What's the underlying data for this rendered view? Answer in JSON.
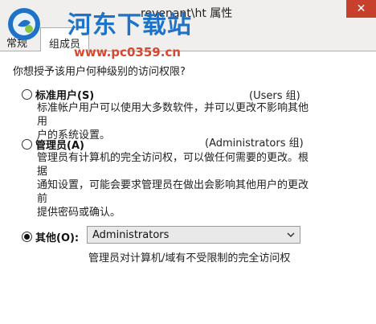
{
  "window": {
    "title": "revenant\\ht 属性",
    "close_glyph": "✕"
  },
  "watermark": {
    "main_text": "河东下载站",
    "url_text": "www.pc0359.cn"
  },
  "tabs": [
    {
      "label": "常规",
      "active": false
    },
    {
      "label": "组成员",
      "active": true
    }
  ],
  "question": "你想授予该用户何种级别的访问权限?",
  "options": [
    {
      "label": "标准用户(S)",
      "group": "(Users 组)",
      "description": [
        "标准帐户用户可以使用大多数软件，并可以更改不影响其他用",
        "户的系统设置。"
      ],
      "checked": false
    },
    {
      "label": "管理员(A)",
      "group": "(Administrators 组)",
      "description": [
        "管理员有计算机的完全访问权，可以做任何需要的更改。根据",
        "通知设置，可能会要求管理员在做出会影响其他用户的更改前",
        "提供密码或确认。"
      ],
      "checked": false
    },
    {
      "label": "其他(O):",
      "checked": true
    }
  ],
  "other_select": {
    "value": "Administrators",
    "description": "管理员对计算机/域有不受限制的完全访问权"
  },
  "colors": {
    "close_button": "#c7402c",
    "watermark_blue": "#1e73c8",
    "watermark_red": "#d8482f",
    "chrome_background": "#f0efed"
  },
  "icons": {
    "logo": "watermark-logo-icon",
    "dropdown": "chevron-down-icon"
  }
}
